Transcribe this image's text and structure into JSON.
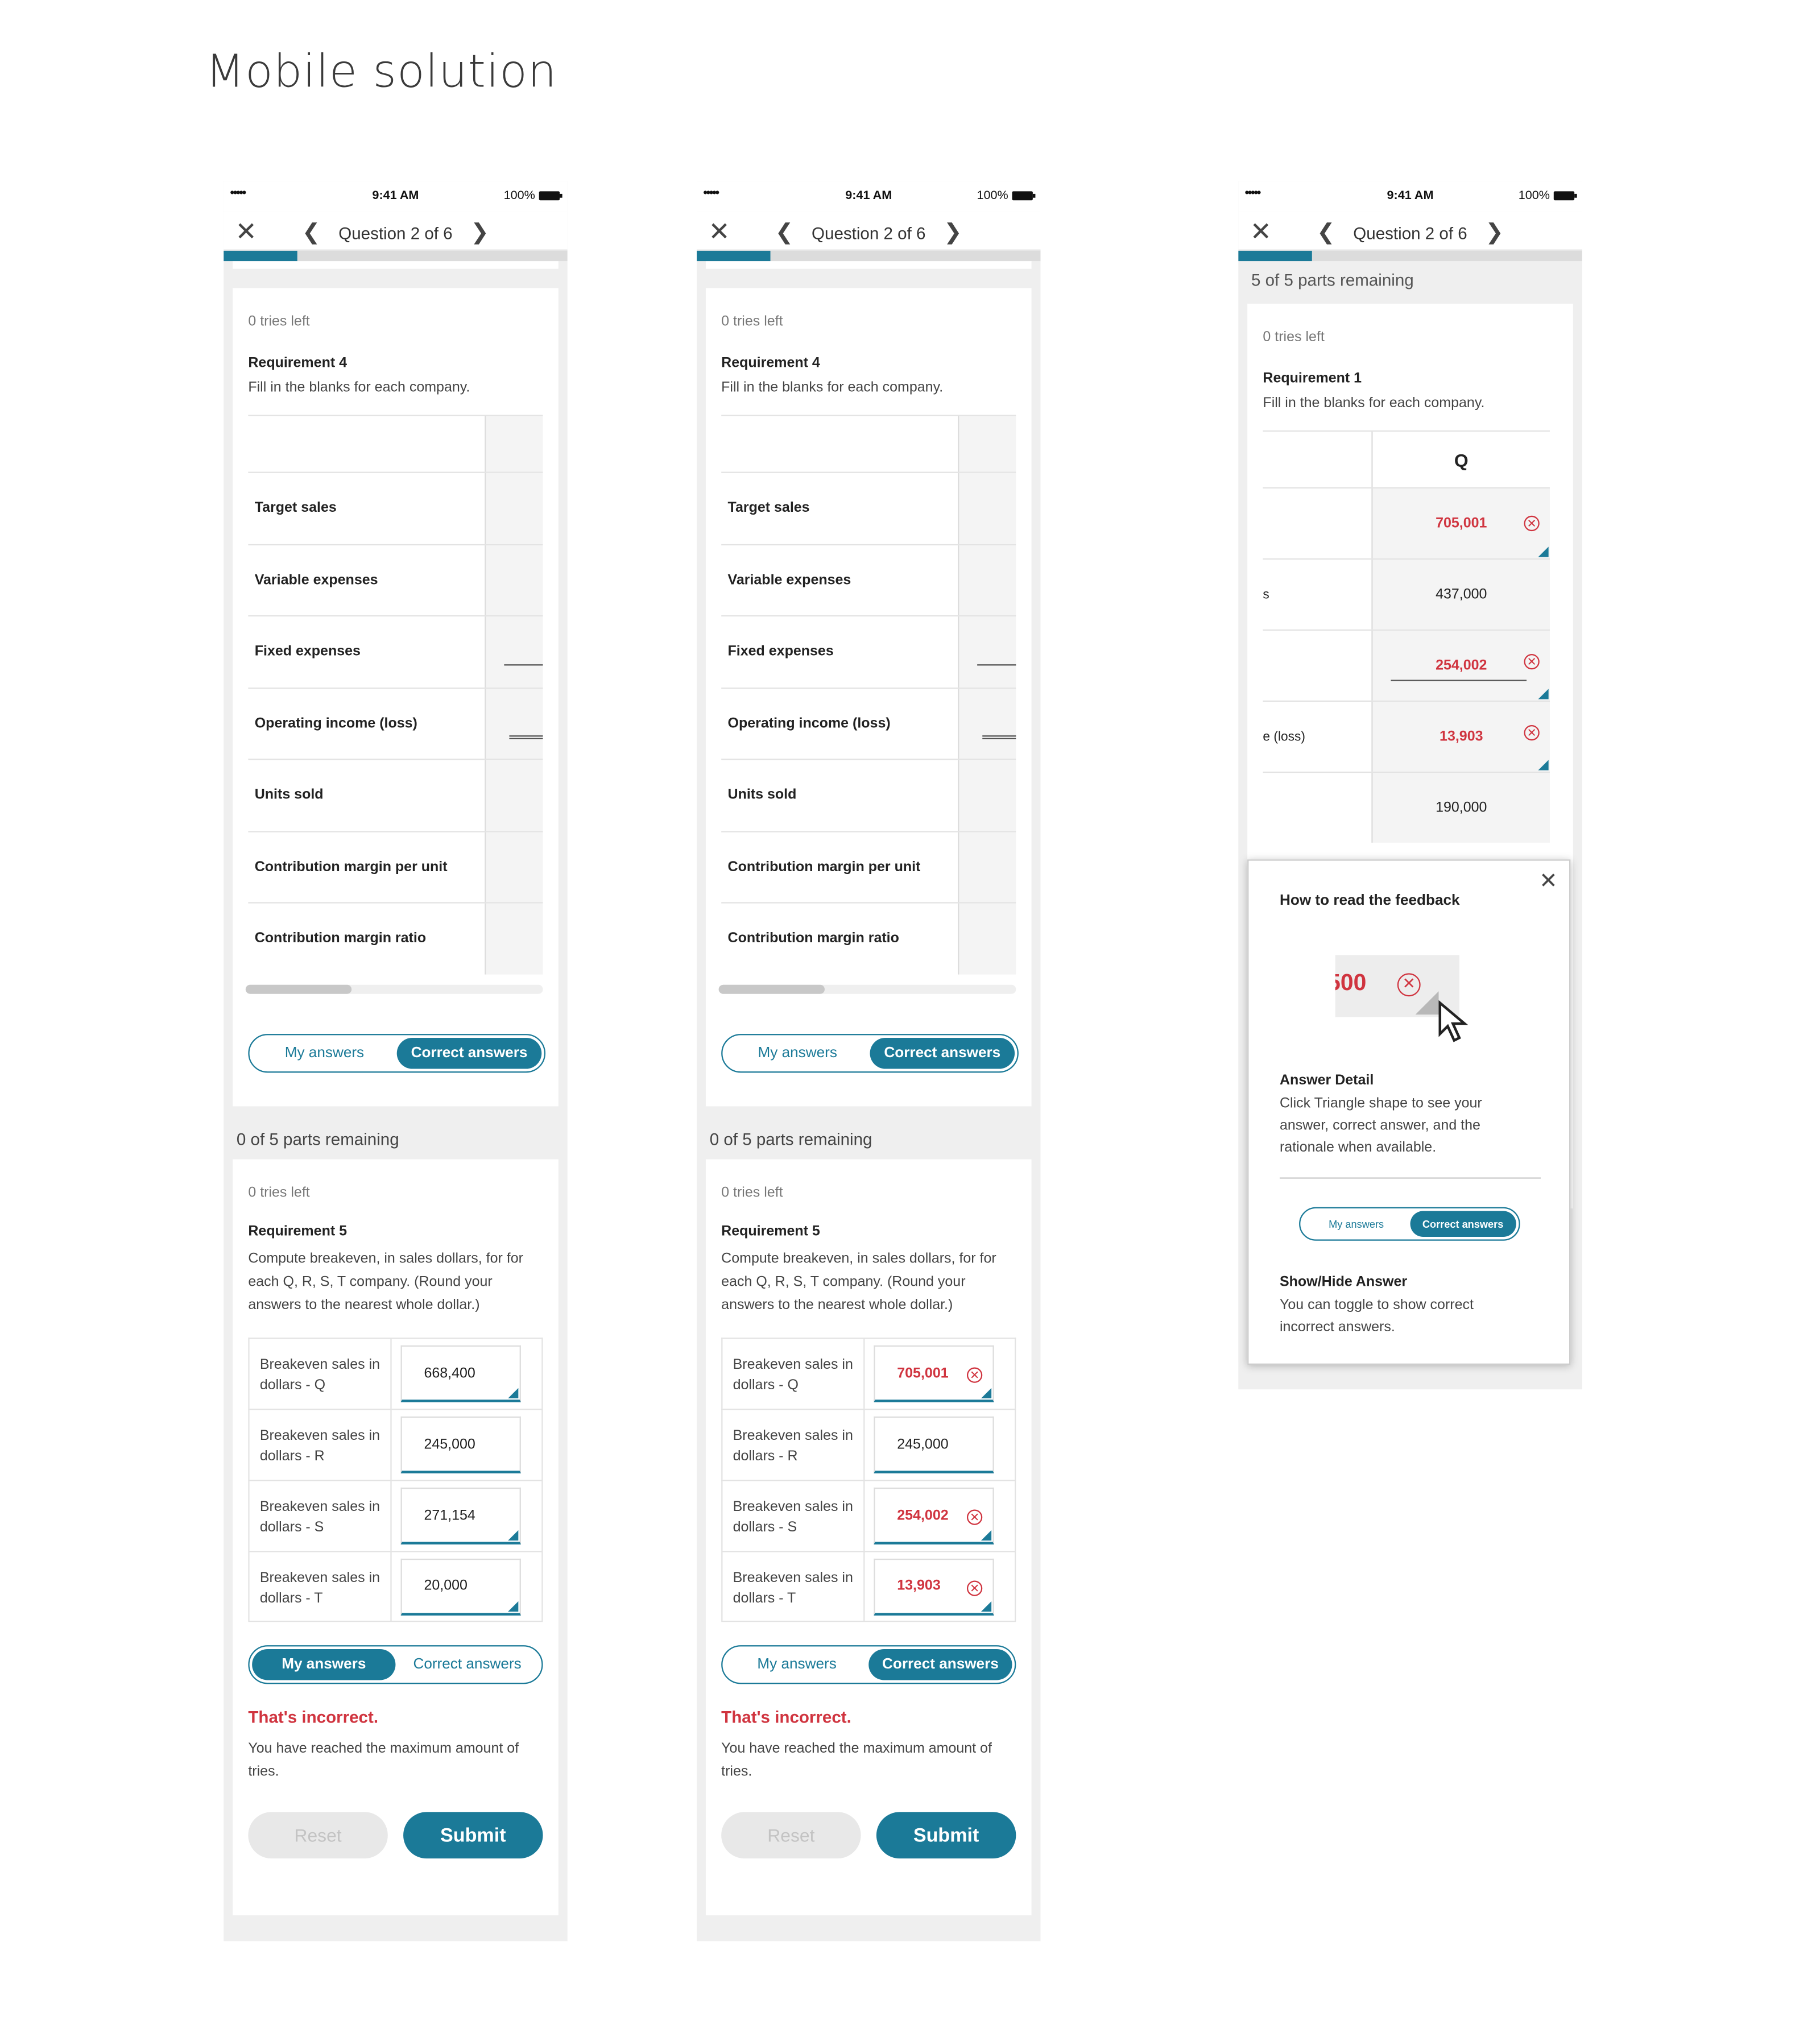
{
  "page_title": "Mobile solution",
  "status": {
    "signal": "•••••",
    "time": "9:41 AM",
    "battery": "100%"
  },
  "nav": {
    "question": "Question 2 of 6"
  },
  "req4": {
    "tries": "0 tries left",
    "title": "Requirement 4",
    "instr": "Fill in the blanks for each company.",
    "rows": [
      "Target sales",
      "Variable expenses",
      "Fixed expenses",
      "Operating income (loss)",
      "Units sold",
      "Contribution margin per unit",
      "Contribution margin ratio"
    ]
  },
  "toggle": {
    "my": "My answers",
    "correct": "Correct answers"
  },
  "parts_remaining": "0 of 5 parts remaining",
  "req5": {
    "tries": "0 tries left",
    "title": "Requirement 5",
    "instr": "Compute breakeven, in sales dollars, for for each Q, R, S, T company. (Round your answers to the nearest whole dollar.)",
    "labels": [
      "Breakeven sales in dollars - Q",
      "Breakeven sales in dollars - R",
      "Breakeven sales in dollars - S",
      "Breakeven sales in dollars - T"
    ],
    "my_values": [
      "668,400",
      "245,000",
      "271,154",
      "20,000"
    ],
    "correct_values": [
      "705,001",
      "245,000",
      "254,002",
      "13,903"
    ]
  },
  "feedback": {
    "error": "That's incorrect.",
    "message": "You have reached the maximum amount of tries."
  },
  "buttons": {
    "reset": "Reset",
    "submit": "Submit"
  },
  "p3": {
    "parts": "5 of 5 parts remaining",
    "tries": "0 tries left",
    "title": "Requirement 1",
    "instr": "Fill in the blanks for each company.",
    "col_header": "Q",
    "row_labels": [
      "",
      "s",
      "",
      "e (loss)",
      ""
    ],
    "values": [
      "705,001",
      "437,000",
      "254,002",
      "13,903",
      "190,000"
    ]
  },
  "popup": {
    "title": "How to read the feedback",
    "sample": "500",
    "detail_title": "Answer Detail",
    "detail_text": "Click Triangle shape to see your answer, correct answer, and the rationale when available.",
    "show_title": "Show/Hide Answer",
    "show_text": "You can toggle to show correct incorrect answers."
  },
  "colors": {
    "accent": "#1b7a98",
    "error": "#d0343f"
  }
}
